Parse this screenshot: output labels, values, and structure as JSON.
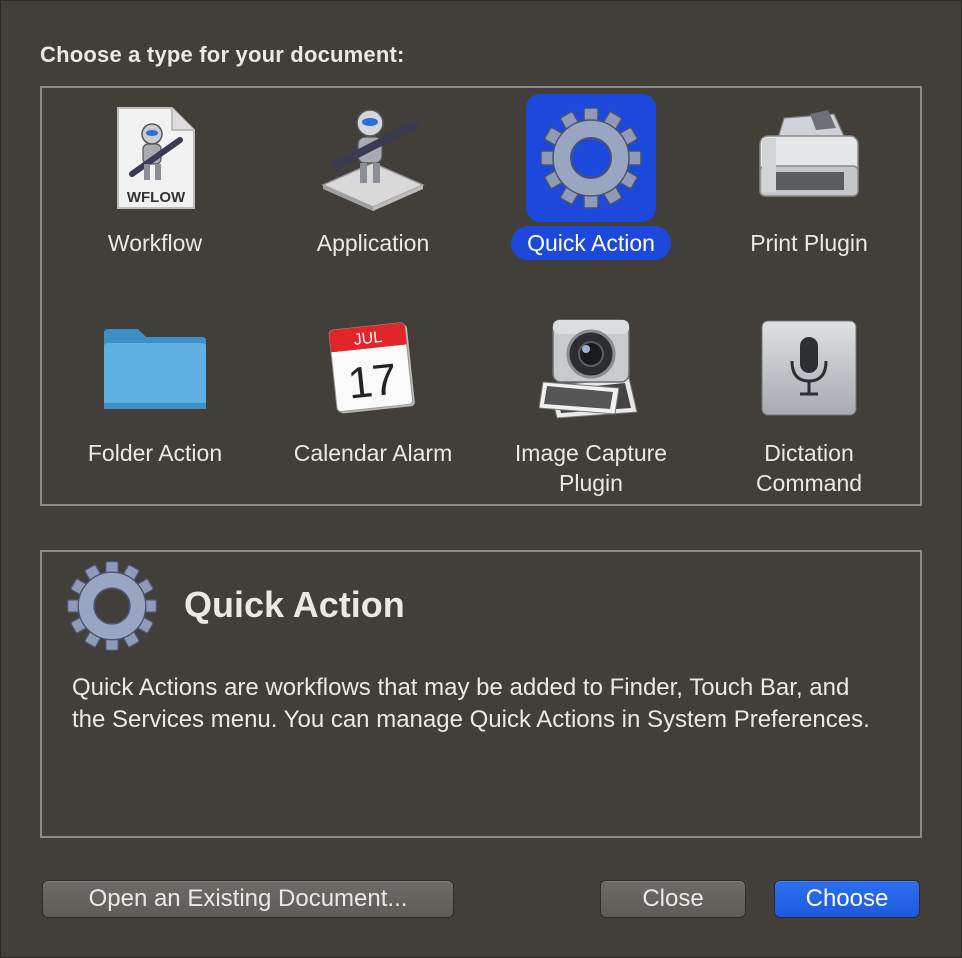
{
  "prompt": "Choose a type for your document:",
  "types": [
    {
      "label": "Workflow",
      "icon": "workflow-document-icon",
      "selected": false
    },
    {
      "label": "Application",
      "icon": "automator-robot-icon",
      "selected": false
    },
    {
      "label": "Quick Action",
      "icon": "gear-icon",
      "selected": true
    },
    {
      "label": "Print Plugin",
      "icon": "printer-icon",
      "selected": false
    },
    {
      "label": "Folder Action",
      "icon": "folder-icon",
      "selected": false
    },
    {
      "label": "Calendar Alarm",
      "icon": "calendar-icon",
      "selected": false
    },
    {
      "label": "Image Capture\nPlugin",
      "icon": "camera-icon",
      "selected": false
    },
    {
      "label": "Dictation\nCommand",
      "icon": "microphone-icon",
      "selected": false
    }
  ],
  "workflow_badge": "WFLOW",
  "calendar": {
    "month": "JUL",
    "day": "17"
  },
  "description": {
    "title": "Quick Action",
    "icon": "gear-icon",
    "text": "Quick Actions are workflows that may be added to Finder, Touch Bar, and the Services menu. You can manage Quick Actions in System Preferences."
  },
  "buttons": {
    "open_existing": "Open an Existing Document...",
    "close": "Close",
    "choose": "Choose"
  },
  "colors": {
    "background": "#423e3a",
    "selection": "#1c49dc",
    "primary_button": "#1d59de"
  }
}
